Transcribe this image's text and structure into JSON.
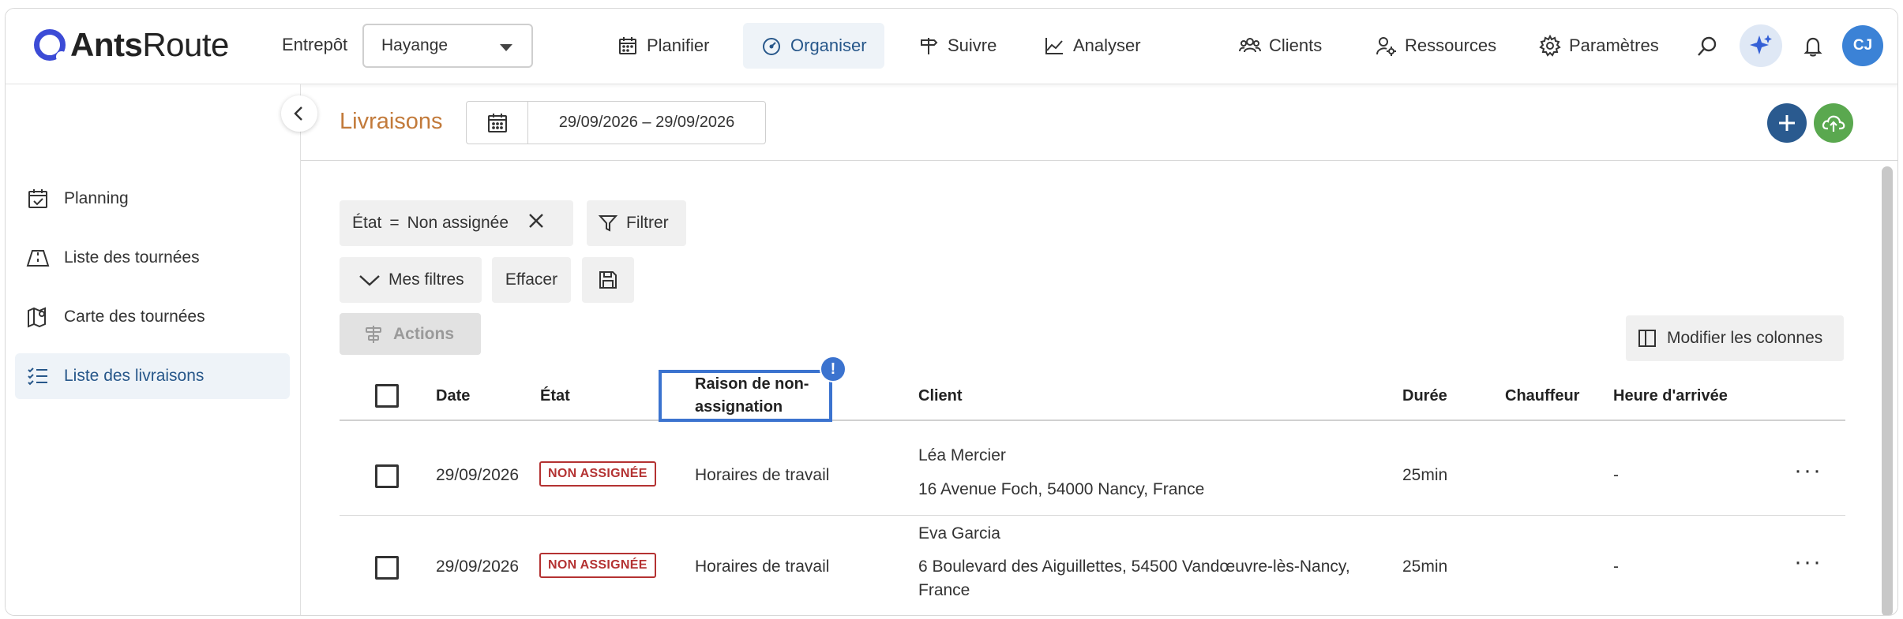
{
  "app": {
    "logo_bold": "Ants",
    "logo_light": "Route"
  },
  "topbar": {
    "warehouse_label": "Entrepôt",
    "warehouse_value": "Hayange",
    "nav": {
      "planifier": "Planifier",
      "organiser": "Organiser",
      "suivre": "Suivre",
      "analyser": "Analyser",
      "clients": "Clients",
      "ressources": "Ressources",
      "parametres": "Paramètres"
    },
    "avatar_initials": "CJ"
  },
  "sidebar": {
    "items": [
      {
        "label": "Planning"
      },
      {
        "label": "Liste des tournées"
      },
      {
        "label": "Carte des tournées"
      },
      {
        "label": "Liste des livraisons"
      }
    ]
  },
  "page": {
    "title": "Livraisons",
    "date_range": "29/09/2026 – 29/09/2026"
  },
  "filters": {
    "active_filter_field": "État",
    "active_filter_op": "=",
    "active_filter_value": "Non assignée",
    "filter_button": "Filtrer",
    "my_filters": "Mes filtres",
    "clear": "Effacer",
    "actions": "Actions",
    "modify_columns": "Modifier les colonnes"
  },
  "table": {
    "headers": {
      "date": "Date",
      "state": "État",
      "reason": "Raison de non-assignation",
      "reason_line1": "Raison de non-",
      "reason_line2": "assignation",
      "client": "Client",
      "duration": "Durée",
      "driver": "Chauffeur",
      "arrival": "Heure d'arrivée"
    },
    "alert_symbol": "!",
    "rows": [
      {
        "date": "29/09/2026",
        "state": "NON ASSIGNÉE",
        "reason": "Horaires de travail",
        "client_name": "Léa Mercier",
        "client_address": "16 Avenue Foch, 54000 Nancy, France",
        "duration": "25min",
        "driver": "",
        "arrival": "-",
        "more": "···"
      },
      {
        "date": "29/09/2026",
        "state": "NON ASSIGNÉE",
        "reason": "Horaires de travail",
        "client_name": "Eva Garcia",
        "client_address_line1": "6 Boulevard des Aiguillettes, 54500 Vandœuvre-lès-Nancy,",
        "client_address_line2": "France",
        "duration": "25min",
        "driver": "",
        "arrival": "-",
        "more": "···"
      }
    ]
  },
  "colors": {
    "accent_blue": "#27578a",
    "title_orange": "#c27a3a",
    "badge_red": "#b43232",
    "highlight_blue": "#3b73cf",
    "add_button": "#2a5a8f",
    "upload_button": "#5aa84f",
    "avatar": "#3b82d6"
  }
}
